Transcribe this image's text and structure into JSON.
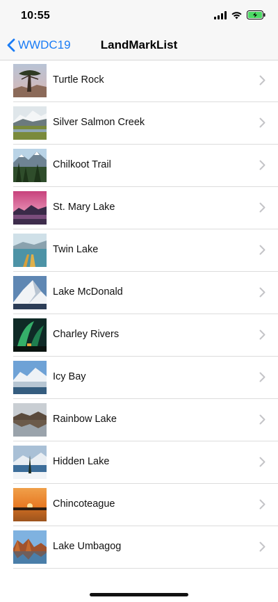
{
  "status_bar": {
    "time": "10:55",
    "icons": [
      "signal-icon",
      "wifi-icon",
      "battery-charging-icon"
    ]
  },
  "nav": {
    "back_label": "WWDC19",
    "title": "LandMarkList"
  },
  "colors": {
    "accent": "#1a7cf5",
    "battery": "#4cd964",
    "separator": "#dcdcdc",
    "chevron": "#c4c4c7"
  },
  "landmarks": [
    {
      "name": "Turtle Rock"
    },
    {
      "name": "Silver Salmon Creek"
    },
    {
      "name": "Chilkoot Trail"
    },
    {
      "name": "St. Mary Lake"
    },
    {
      "name": "Twin Lake"
    },
    {
      "name": "Lake McDonald"
    },
    {
      "name": "Charley Rivers"
    },
    {
      "name": "Icy Bay"
    },
    {
      "name": "Rainbow Lake"
    },
    {
      "name": "Hidden Lake"
    },
    {
      "name": "Chincoteague"
    },
    {
      "name": "Lake Umbagog"
    }
  ]
}
